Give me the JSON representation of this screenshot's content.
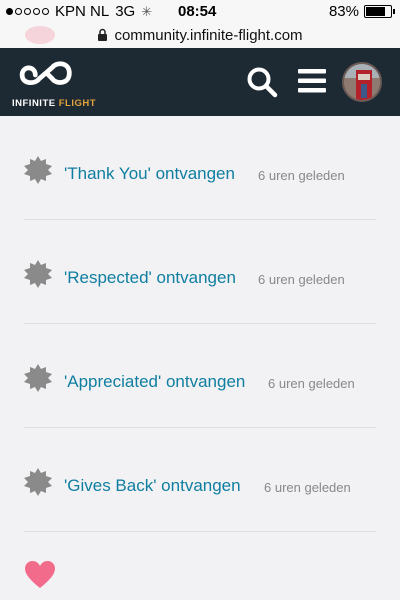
{
  "status_bar": {
    "carrier": "KPN NL",
    "network": "3G",
    "time": "08:54",
    "battery_percent": "83%",
    "battery_level": 0.83,
    "signal_bars_filled": 1,
    "signal_bars_total": 5
  },
  "browser": {
    "url": "community.infinite-flight.com"
  },
  "header": {
    "brand_word": "INFINITE",
    "brand_accent": "FLIGHT",
    "brand_accent_color": "#e2a13b",
    "background_color": "#1e2a33",
    "icons": [
      "infinity-logo",
      "search-icon",
      "hamburger-menu-icon",
      "user-avatar"
    ]
  },
  "notifications": [
    {
      "title": "'Thank You' ontvangen",
      "time": "6 uren geleden",
      "icon": "badge-icon"
    },
    {
      "title": "'Respected' ontvangen",
      "time": "6 uren geleden",
      "icon": "badge-icon"
    },
    {
      "title": "'Appreciated' ontvangen",
      "time": "6 uren geleden",
      "icon": "badge-icon"
    },
    {
      "title": "'Gives Back' ontvangen",
      "time": "6 uren geleden",
      "icon": "badge-icon"
    }
  ],
  "colors": {
    "link": "#0f7ea0",
    "badge": "#8a8a8a",
    "heart": "#f26b8a"
  },
  "footer_icon": "heart-icon"
}
